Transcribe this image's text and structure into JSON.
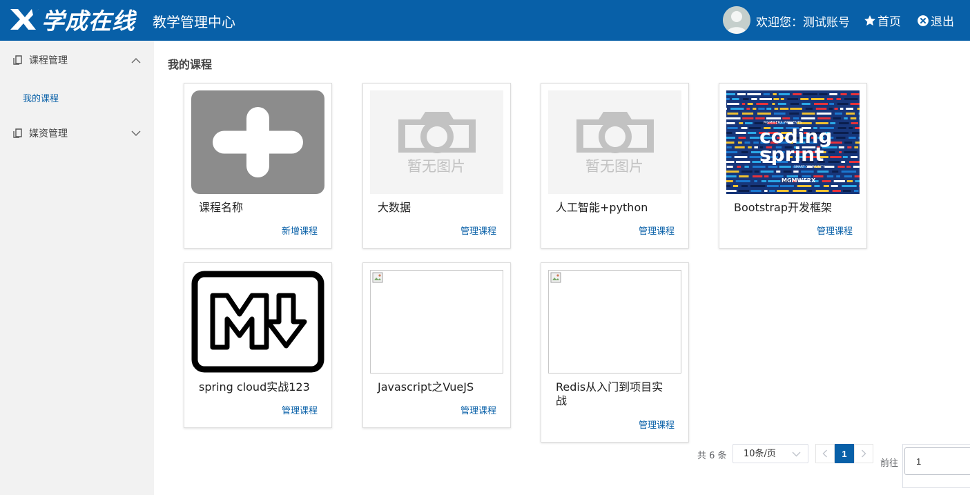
{
  "header": {
    "logo_text": "学成在线",
    "system_title": "教学管理中心",
    "welcome": "欢迎您：测试账号",
    "home_label": "首页",
    "exit_label": "退出"
  },
  "sidebar": {
    "groups": [
      {
        "label": "课程管理",
        "expanded": true,
        "items": [
          {
            "label": "我的课程"
          }
        ]
      },
      {
        "label": "媒资管理",
        "expanded": false,
        "items": []
      }
    ]
  },
  "main": {
    "title": "我的课程",
    "cards": [
      {
        "name": "课程名称",
        "action": "新增课程",
        "thumb": "add-course"
      },
      {
        "name": "大数据",
        "action": "管理课程",
        "thumb": "no-image",
        "thumb_text": "暂无图片"
      },
      {
        "name": "人工智能+python",
        "action": "管理课程",
        "thumb": "no-image",
        "thumb_text": "暂无图片"
      },
      {
        "name": "Bootstrap开发框架",
        "action": "管理课程",
        "thumb": "coding-sprint",
        "thumb_lines": [
          "MGMWERX PRESENTS",
          "coding",
          "sprint",
          "SMART COMMUNITY",
          "MGMWERX"
        ]
      },
      {
        "name": "spring cloud实战123",
        "action": "管理课程",
        "thumb": "markdown-logo"
      },
      {
        "name": "Javascript之VueJS",
        "action": "管理课程",
        "thumb": "broken-image"
      },
      {
        "name": "Redis从入门到项目实战",
        "action": "管理课程",
        "thumb": "broken-image"
      }
    ]
  },
  "pagination": {
    "total": "共 6 条",
    "page_size": "10条/页",
    "current_page": "1",
    "goto_label": "前往",
    "goto_value": "1"
  },
  "colors": {
    "brand": "#0860a8",
    "sidebar_bg": "#f2f2f2",
    "link": "#0860a8"
  }
}
